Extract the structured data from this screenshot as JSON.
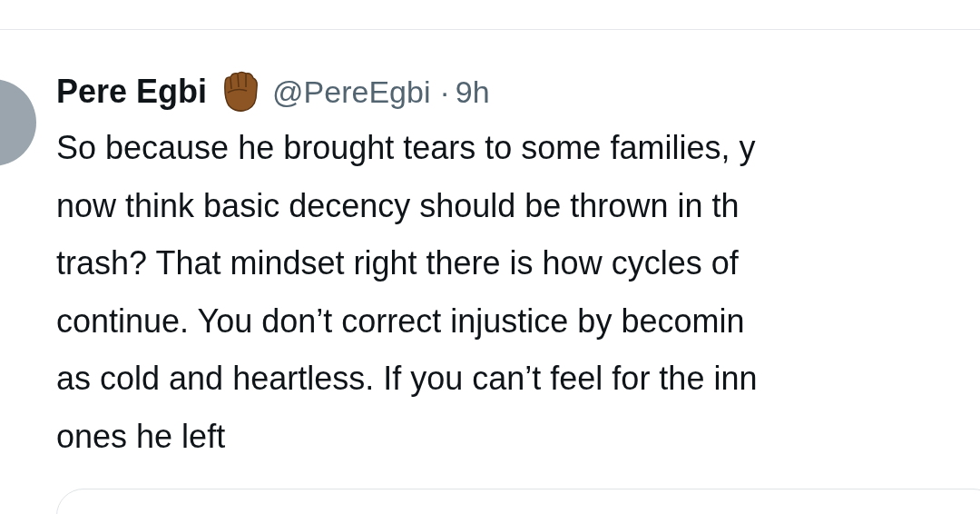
{
  "tweet": {
    "author": {
      "name": "Pere Egbi",
      "handle": "@PereEgbi",
      "separator": "·",
      "time": "9h"
    },
    "lines": [
      "So because he brought tears to some families, y",
      "now think basic decency should be thrown in th",
      "trash? That mindset right there is how cycles of",
      "continue. You don’t correct injustice by becomin",
      "as cold and heartless. If you can’t feel for the inn",
      "ones he left"
    ]
  }
}
